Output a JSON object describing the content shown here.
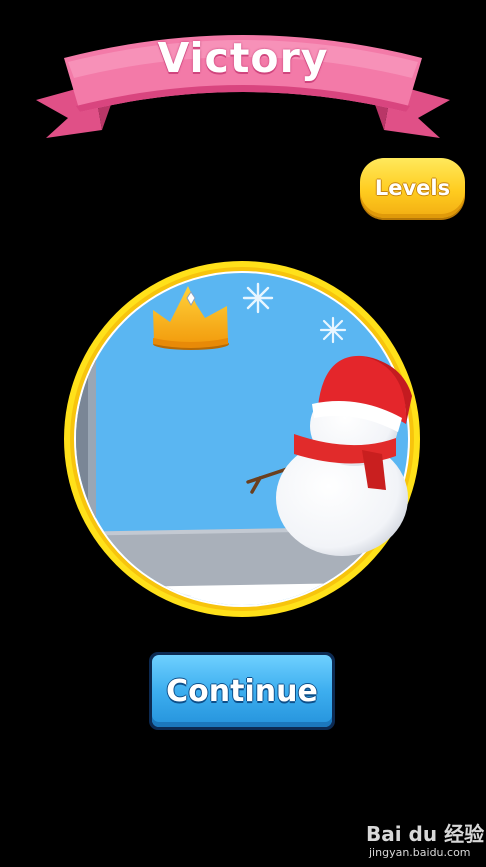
{
  "header": {
    "title": "Victory"
  },
  "levels_button": {
    "label": "Levels"
  },
  "preview": {
    "icons": [
      "crown-icon",
      "snowflake-icon",
      "snowman-icon"
    ]
  },
  "continue_button": {
    "label": "Continue"
  },
  "watermark": {
    "logo_text": "Bai du 经验",
    "url": "jingyan.baidu.com"
  },
  "colors": {
    "banner": "#f06a9e",
    "levels_button": "#ffcc1f",
    "continue_button": "#3daeef",
    "preview_ring": "#ffe11a",
    "background": "#000000"
  }
}
